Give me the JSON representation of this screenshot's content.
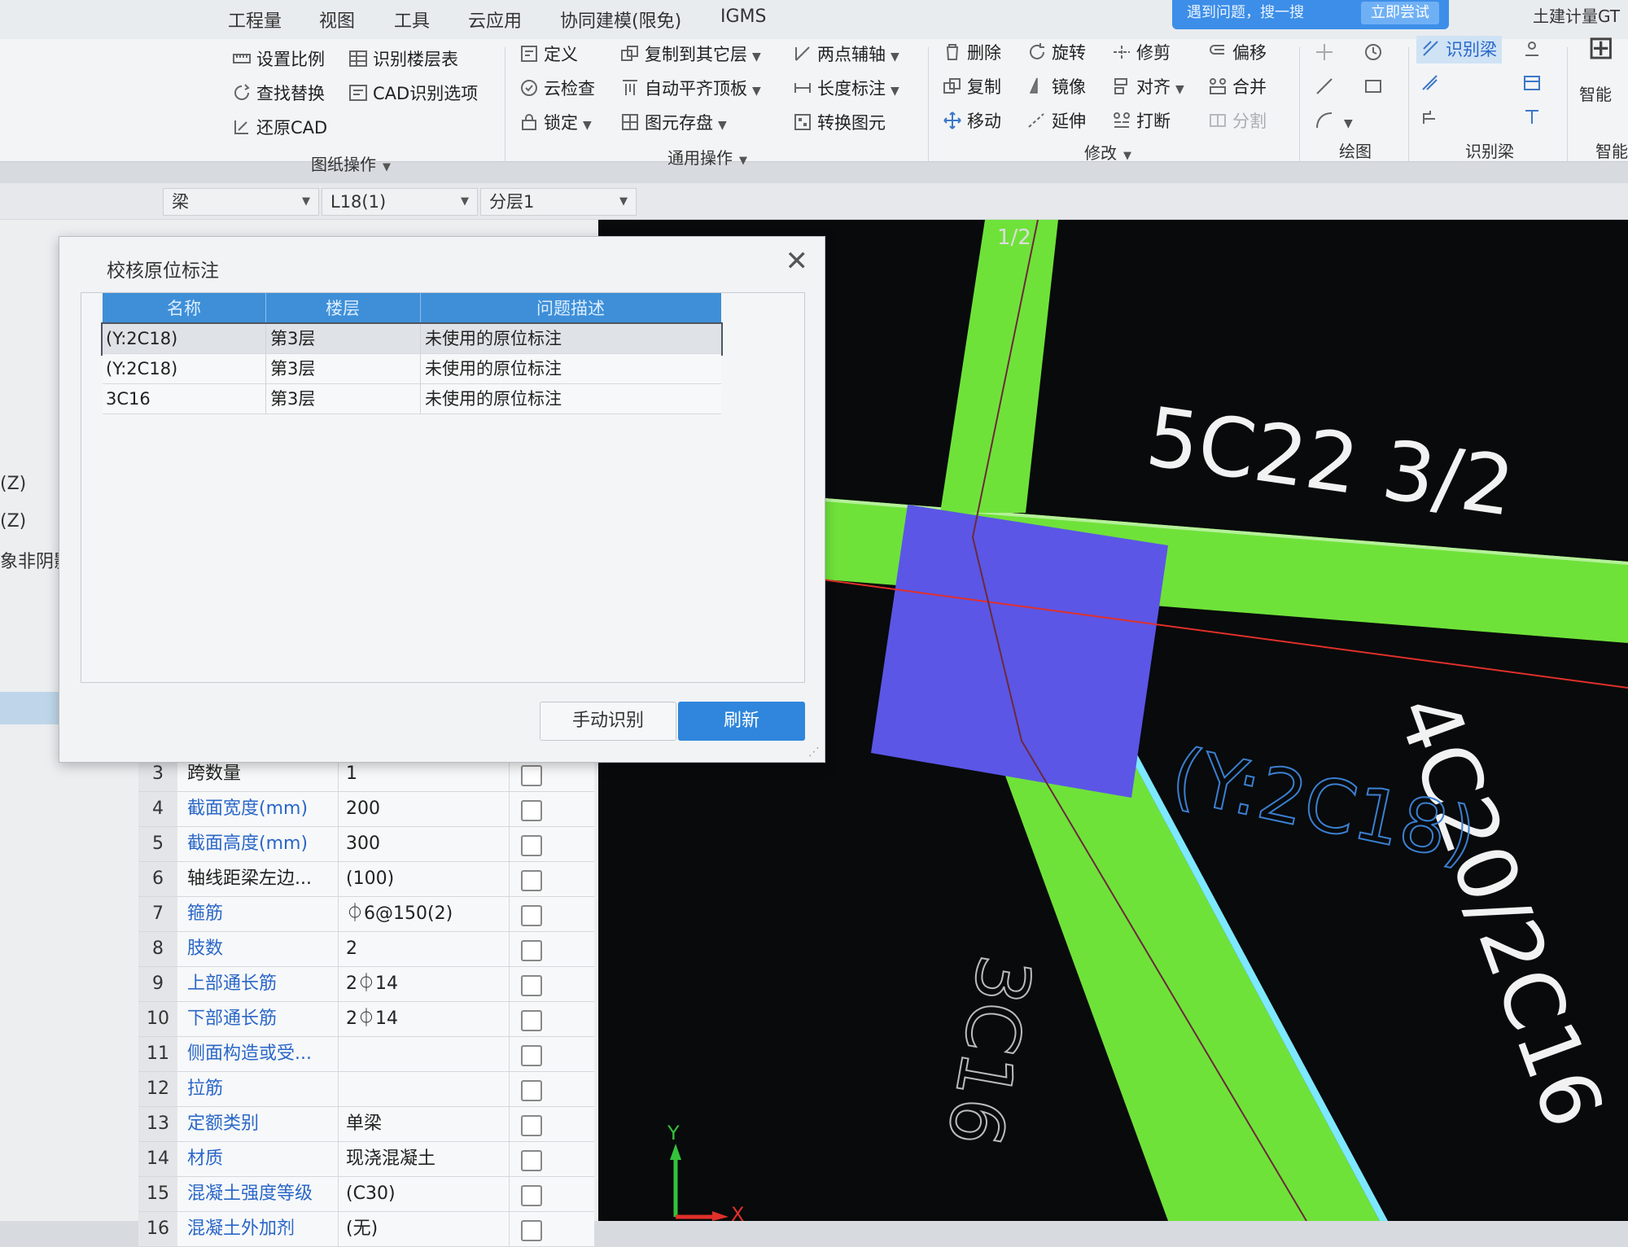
{
  "menu": {
    "tabs": [
      "工程量",
      "视图",
      "工具",
      "云应用",
      "协同建模(限免)",
      "IGMS"
    ],
    "notice_text": "遇到问题，搜一搜",
    "notice_button": "立即尝试",
    "app_title": "土建计量GT"
  },
  "ribbon": {
    "drawing_ops": {
      "set_scale": "设置比例",
      "identify_floor_table": "识别楼层表",
      "find_replace": "查找替换",
      "cad_options": "CAD识别选项",
      "restore_cad": "还原CAD",
      "label": "图纸操作"
    },
    "common_ops": {
      "define": "定义",
      "copy_to_other_floor": "复制到其它层",
      "two_point_axis": "两点辅轴",
      "cloud_check": "云检查",
      "auto_align_top": "自动平齐顶板",
      "length_mark": "长度标注",
      "lock": "锁定",
      "element_store": "图元存盘",
      "convert_element": "转换图元",
      "label": "通用操作"
    },
    "modify": {
      "delete": "删除",
      "rotate": "旋转",
      "trim": "修剪",
      "offset": "偏移",
      "copy": "复制",
      "mirror": "镜像",
      "align": "对齐",
      "merge": "合并",
      "move": "移动",
      "extend": "延伸",
      "break": "打断",
      "split": "分割",
      "label": "修改"
    },
    "draw_label": "绘图",
    "identify_beam": "识别梁",
    "identify_beam_label": "识别梁",
    "smart_label": "智能"
  },
  "selectors": {
    "type": "梁",
    "element": "L18(1)",
    "layer": "分层1"
  },
  "side_labels": [
    "(Z)",
    "(Z)",
    "象非阴影["
  ],
  "dialog": {
    "title": "校核原位标注",
    "columns": [
      "名称",
      "楼层",
      "问题描述"
    ],
    "rows": [
      {
        "name": "(Y:2C18)",
        "floor": "第3层",
        "desc": "未使用的原位标注"
      },
      {
        "name": "(Y:2C18)",
        "floor": "第3层",
        "desc": "未使用的原位标注"
      },
      {
        "name": "3C16",
        "floor": "第3层",
        "desc": "未使用的原位标注"
      }
    ],
    "manual_button": "手动识别",
    "refresh_button": "刷新"
  },
  "properties": [
    {
      "num": "3",
      "name": "跨数量",
      "value": "1",
      "blue": false
    },
    {
      "num": "4",
      "name": "截面宽度(mm)",
      "value": "200",
      "blue": true
    },
    {
      "num": "5",
      "name": "截面高度(mm)",
      "value": "300",
      "blue": true
    },
    {
      "num": "6",
      "name": "轴线距梁左边...",
      "value": "(100)",
      "blue": false
    },
    {
      "num": "7",
      "name": "箍筋",
      "value": "⏀6@150(2)",
      "blue": true
    },
    {
      "num": "8",
      "name": "肢数",
      "value": "2",
      "blue": true
    },
    {
      "num": "9",
      "name": "上部通长筋",
      "value": "2⏀14",
      "blue": true
    },
    {
      "num": "10",
      "name": "下部通长筋",
      "value": "2⏀14",
      "blue": true
    },
    {
      "num": "11",
      "name": "侧面构造或受...",
      "value": "",
      "blue": true
    },
    {
      "num": "12",
      "name": "拉筋",
      "value": "",
      "blue": true
    },
    {
      "num": "13",
      "name": "定额类别",
      "value": "单梁",
      "blue": true
    },
    {
      "num": "14",
      "name": "材质",
      "value": "现浇混凝土",
      "blue": true
    },
    {
      "num": "15",
      "name": "混凝土强度等级",
      "value": "(C30)",
      "blue": true
    },
    {
      "num": "16",
      "name": "混凝土外加剂",
      "value": "(无)",
      "blue": true
    }
  ],
  "cad": {
    "axis_label": "1/2",
    "label_top": "5C22 3/2",
    "label_right": "4C20/2C16",
    "label_blue": "(Y:2C18)",
    "label_left": "3C16",
    "axis_y": "Y",
    "axis_x": "X",
    "colors": {
      "beam": "#6fe23a",
      "column": "#5b56e6",
      "background": "#080a0b",
      "axis_red": "#e0302a"
    }
  }
}
